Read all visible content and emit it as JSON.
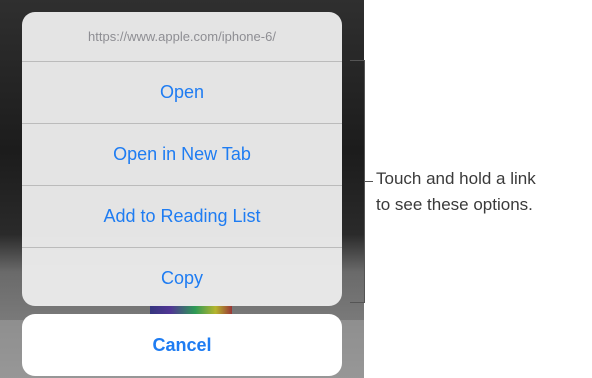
{
  "action_sheet": {
    "url": "https://www.apple.com/iphone-6/",
    "items": [
      {
        "label": "Open"
      },
      {
        "label": "Open in New Tab"
      },
      {
        "label": "Add to Reading List"
      },
      {
        "label": "Copy"
      }
    ],
    "cancel_label": "Cancel"
  },
  "callout": {
    "line1": "Touch and hold a link",
    "line2": "to see these options."
  },
  "colors": {
    "accent": "#1e7cf2",
    "sheet_background": "#ececec",
    "title_text": "#8e8e93"
  }
}
